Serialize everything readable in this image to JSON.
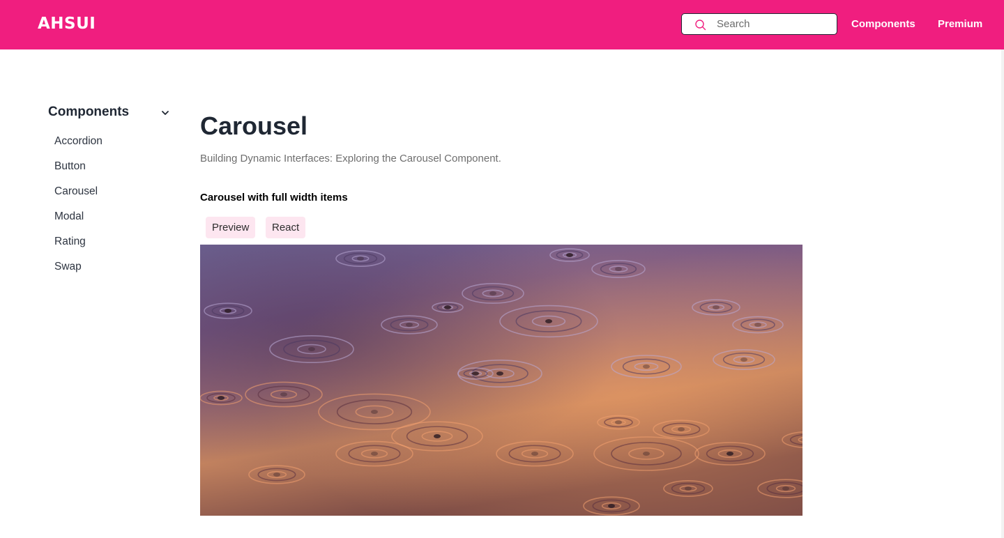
{
  "header": {
    "logo": "AHSUI",
    "search": {
      "placeholder": "Search",
      "value": ""
    },
    "nav": [
      {
        "label": "Components"
      },
      {
        "label": "Premium"
      }
    ],
    "brand_color": "#f01e7f"
  },
  "sidebar": {
    "heading": "Components",
    "items": [
      {
        "label": "Accordion"
      },
      {
        "label": "Button"
      },
      {
        "label": "Carousel"
      },
      {
        "label": "Modal"
      },
      {
        "label": "Rating"
      },
      {
        "label": "Swap"
      }
    ]
  },
  "main": {
    "title": "Carousel",
    "subtitle": "Building Dynamic Interfaces: Exploring the Carousel Component.",
    "section_title": "Carousel with full width items",
    "tabs": [
      {
        "label": "Preview"
      },
      {
        "label": "React"
      }
    ],
    "carousel": {
      "slide_image": "rain-ripples-on-water"
    }
  }
}
